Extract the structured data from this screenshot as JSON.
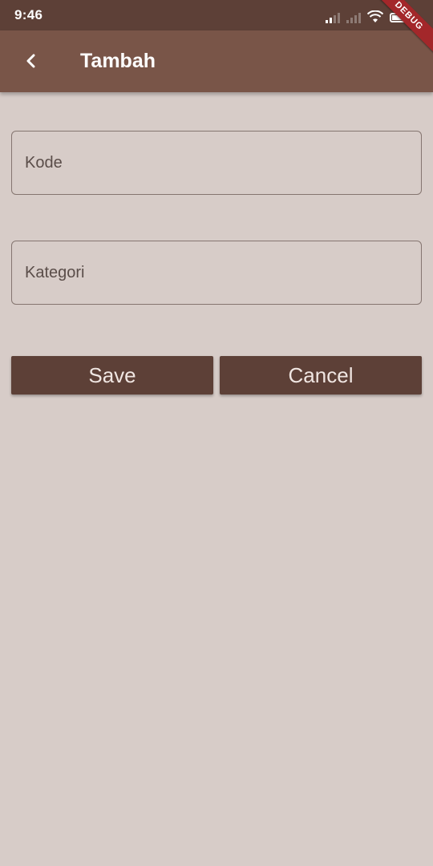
{
  "status_bar": {
    "time": "9:46"
  },
  "app_bar": {
    "title": "Tambah",
    "back_icon": "chevron-left-icon"
  },
  "debug_banner": "DEBUG",
  "form": {
    "kode_placeholder": "Kode",
    "kode_value": "",
    "kategori_placeholder": "Kategori",
    "kategori_value": ""
  },
  "actions": {
    "save_label": "Save",
    "cancel_label": "Cancel"
  },
  "colors": {
    "background": "#d7ccc8",
    "status_bar": "#5d4037",
    "app_bar": "#795548",
    "button": "#5d4037",
    "debug_ribbon": "#a3272a"
  }
}
